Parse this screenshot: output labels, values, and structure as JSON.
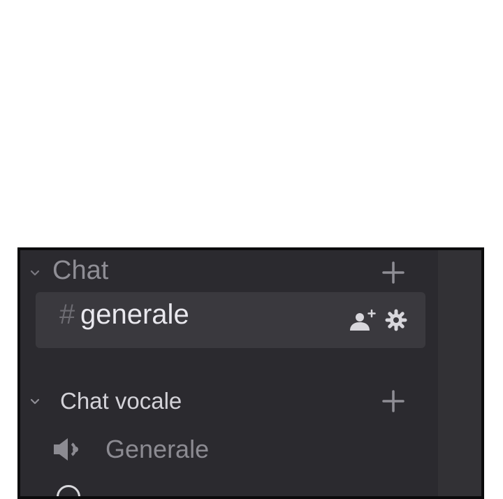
{
  "sidebar": {
    "categories": [
      {
        "label": "Chat",
        "channels": [
          {
            "prefix": "#",
            "name": "generale",
            "icons": [
              "add-member-icon",
              "gear-icon"
            ]
          }
        ]
      },
      {
        "label": "Chat vocale",
        "channels": [
          {
            "name": "Generale",
            "icon": "speaker-icon"
          }
        ]
      }
    ]
  },
  "colors": {
    "background": "#2b2a2f",
    "selected_row": "#3a393e",
    "muted_text": "#8f8e95",
    "active_text": "#e9e8ee"
  }
}
